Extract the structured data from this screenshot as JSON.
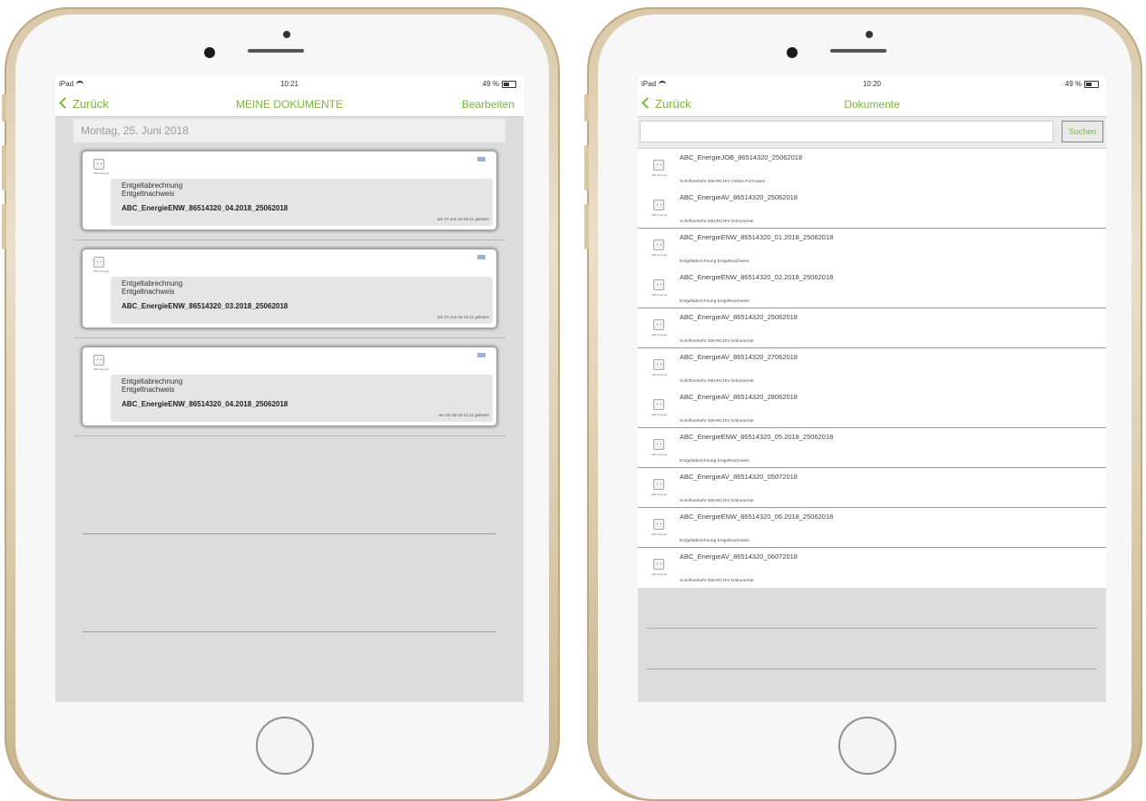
{
  "left": {
    "status": {
      "carrier": "iPad",
      "time": "10:21",
      "battery": "49 %"
    },
    "nav": {
      "back": "Zurück",
      "title": "MEINE DOKUMENTE",
      "action": "Bearbeiten"
    },
    "date_header": "Montag, 25. Juni 2018",
    "cards": [
      {
        "icon_label": "ABC Energie",
        "category_line1": "Entgeltabrechnung",
        "category_line2": "Entgeltnachweis",
        "file": "ABC_EnergieENW_86514320_04.2018_25062018",
        "read": "am 27-Jun-18 05:11 gelesen"
      },
      {
        "icon_label": "ABC Energie",
        "category_line1": "Entgeltabrechnung",
        "category_line2": "Entgeltnachweis",
        "file": "ABC_EnergieENW_86514320_03.2018_25062018",
        "read": "am 27-Jun-18 10:11 gelesen"
      },
      {
        "icon_label": "ABC Energie",
        "category_line1": "Entgeltabrechnung",
        "category_line2": "Entgeltnachweis",
        "file": "ABC_EnergieENW_86514320_04.2018_25062018",
        "read": "am 04-Jul-18 12:11 gelesen"
      }
    ]
  },
  "right": {
    "status": {
      "carrier": "iPad",
      "time": "10:20",
      "battery": "49 %"
    },
    "nav": {
      "back": "Zurück",
      "title": "Dokumente"
    },
    "search": {
      "placeholder": "",
      "button": "Suchen"
    },
    "items": [
      {
        "name": "ABC_EnergieJOB_86514320_25062018",
        "category": "Schriftverkehr DBARCHIV Online-Formulare"
      },
      {
        "name": "ABC_EnergieAV_86514320_25062018",
        "category": "Schriftverkehr DBARCHIV Dokumente"
      },
      {
        "name": "ABC_EnergieENW_86514320_01.2018_25062018",
        "category": "Entgeltabrechnung Entgeltnachweis"
      },
      {
        "name": "ABC_EnergieENW_86514320_02.2018_25062018",
        "category": "Entgeltabrechnung Entgeltnachweis"
      },
      {
        "name": "ABC_EnergieAV_86514320_25062018",
        "category": "Schriftverkehr DBARCHIV Dokumente"
      },
      {
        "name": "ABC_EnergieAV_86514320_27062018",
        "category": "Schriftverkehr DBARCHIV Dokumente"
      },
      {
        "name": "ABC_EnergieAV_86514320_28062018",
        "category": "Schriftverkehr DBARCHIV Dokumente"
      },
      {
        "name": "ABC_EnergieENW_86514320_05.2018_25062018",
        "category": "Entgeltabrechnung Entgeltnachweis"
      },
      {
        "name": "ABC_EnergieAV_86514320_05072018",
        "category": "Schriftverkehr DBARCHIV Dokumente"
      },
      {
        "name": "ABC_EnergieENW_86514320_06.2018_25062018",
        "category": "Entgeltabrechnung Entgeltnachweis"
      },
      {
        "name": "ABC_EnergieAV_86514320_06072018",
        "category": "Schriftverkehr DBARCHIV Dokumente"
      }
    ],
    "icon_label": "ABC Energie"
  },
  "colors": {
    "accent": "#7ab83a",
    "screen_bg": "#dcdcdc"
  }
}
